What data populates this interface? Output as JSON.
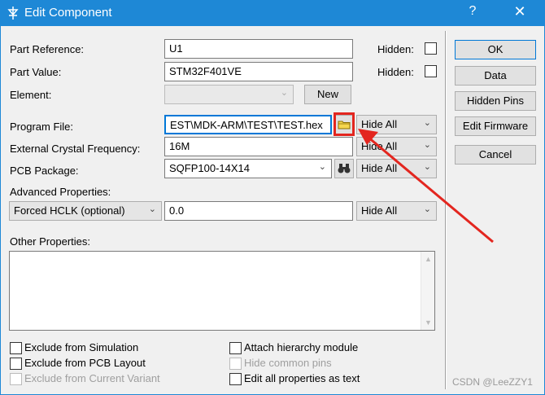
{
  "window": {
    "title": "Edit Component",
    "help_glyph": "?",
    "close_glyph": "✕"
  },
  "fields": {
    "part_reference": {
      "label": "Part Reference:",
      "value": "U1",
      "hidden_label": "Hidden:"
    },
    "part_value": {
      "label": "Part Value:",
      "value": "STM32F401VE",
      "hidden_label": "Hidden:"
    },
    "element": {
      "label": "Element:",
      "value": "",
      "new_button": "New"
    },
    "program_file": {
      "label": "Program File:",
      "value": "EST\\MDK-ARM\\TEST\\TEST.hex",
      "visibility": "Hide All"
    },
    "crystal": {
      "label": "External Crystal Frequency:",
      "value": "16M",
      "visibility": "Hide All"
    },
    "pcb_package": {
      "label": "PCB Package:",
      "value": "SQFP100-14X14",
      "visibility": "Hide All"
    },
    "advanced": {
      "label": "Advanced Properties:",
      "property": "Forced HCLK (optional)",
      "value": "0.0",
      "visibility": "Hide All"
    },
    "other": {
      "label": "Other Properties:",
      "value": ""
    }
  },
  "checkboxes": {
    "exclude_simulation": "Exclude from Simulation",
    "exclude_pcb": "Exclude from PCB Layout",
    "exclude_variant": "Exclude from Current Variant",
    "attach_hierarchy": "Attach hierarchy module",
    "hide_common_pins": "Hide common pins",
    "edit_all_text": "Edit all properties as text"
  },
  "buttons": {
    "ok": "OK",
    "data": "Data",
    "hidden_pins": "Hidden Pins",
    "edit_firmware": "Edit Firmware",
    "cancel": "Cancel"
  },
  "annotation": {
    "highlight_color": "#e3261f"
  },
  "watermark": "CSDN @LeeZZY1",
  "colors": {
    "titlebar": "#1e88d6",
    "dialog": "#f0f0f0"
  },
  "icons": {
    "app": "component-icon",
    "browse": "folder-icon",
    "package": "binoculars-icon"
  }
}
